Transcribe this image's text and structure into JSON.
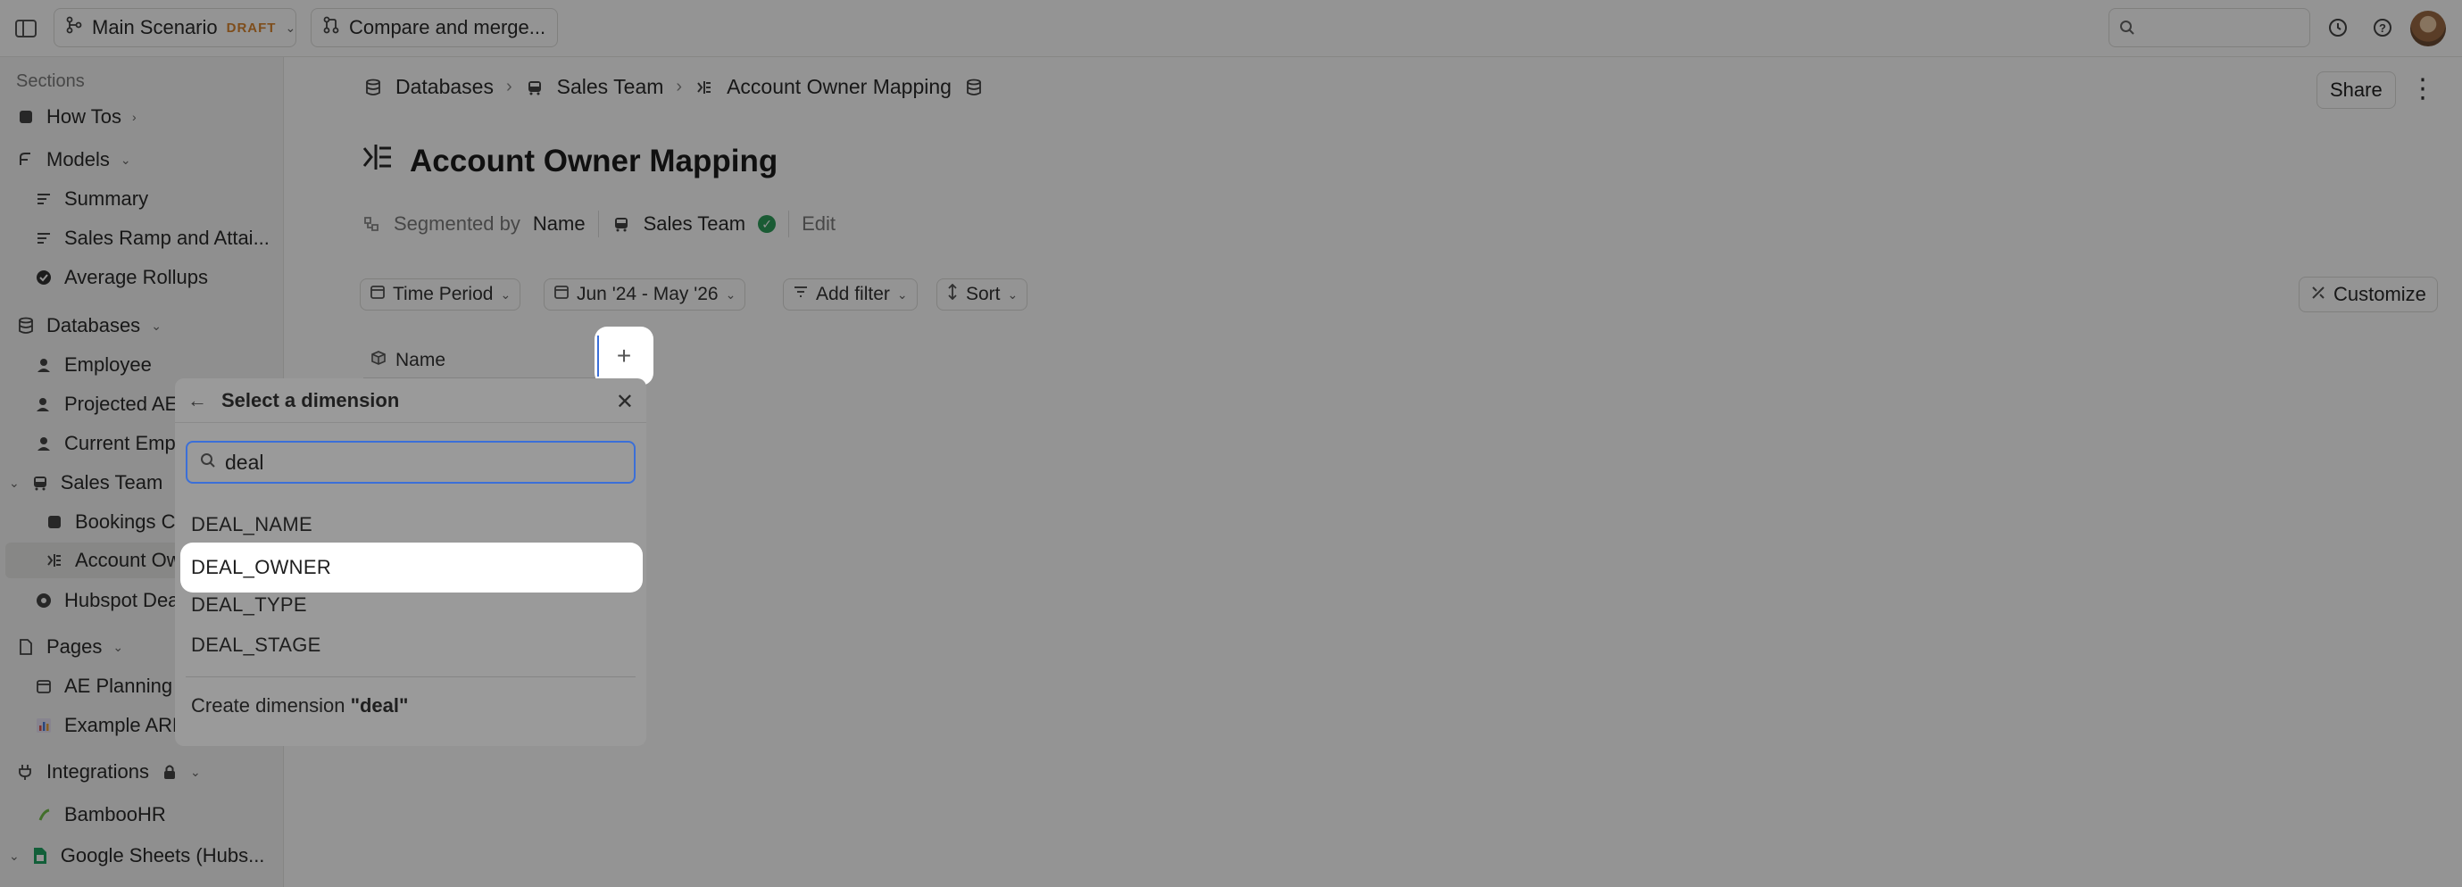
{
  "topbar": {
    "scenario": "Main Scenario",
    "draft_badge": "DRAFT",
    "compare": "Compare and merge..."
  },
  "sidebar": {
    "sections_label": "Sections",
    "how_tos": "How Tos",
    "models": "Models",
    "summary": "Summary",
    "sales_ramp": "Sales Ramp and Attai...",
    "average_rollups": "Average Rollups",
    "databases": "Databases",
    "employee": "Employee",
    "projected_ae": "Projected AE",
    "current_emp": "Current Emp",
    "sales_team": "Sales Team",
    "bookings": "Bookings C",
    "account_ow": "Account Ow",
    "hubspot": "Hubspot Dea",
    "pages": "Pages",
    "ae_planning": "AE Planning",
    "example_arr": "Example ARR",
    "integrations": "Integrations",
    "bamboohr": "BambooHR",
    "google_sheets": "Google Sheets (Hubs..."
  },
  "breadcrumb": {
    "databases": "Databases",
    "sales_team": "Sales Team",
    "current": "Account Owner Mapping"
  },
  "header": {
    "share": "Share",
    "title": "Account Owner Mapping"
  },
  "segment": {
    "label": "Segmented by",
    "name": "Name",
    "team": "Sales Team",
    "edit": "Edit"
  },
  "filters": {
    "time_period": "Time Period",
    "date_range": "Jun '24 - May '26",
    "add_filter": "Add filter",
    "sort": "Sort",
    "customize": "Customize"
  },
  "table": {
    "name_col": "Name"
  },
  "popup": {
    "title": "Select a dimension",
    "search_value": "deal",
    "options": [
      "DEAL_NAME",
      "DEAL_OWNER",
      "DEAL_TYPE",
      "DEAL_STAGE"
    ],
    "create_prefix": "Create dimension",
    "create_value": "\"deal\""
  }
}
